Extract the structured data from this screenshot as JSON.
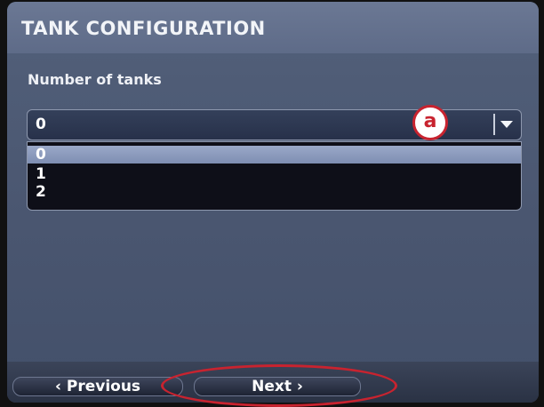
{
  "header": {
    "title": "TANK CONFIGURATION"
  },
  "form": {
    "label": "Number of tanks",
    "select": {
      "value": "0",
      "options": [
        "0",
        "1",
        "2"
      ],
      "selected_index": 0
    }
  },
  "annotations": {
    "callout": "a"
  },
  "footer": {
    "previous": "‹ Previous",
    "next": "Next ›"
  },
  "colors": {
    "annotation_red": "#c8232f",
    "highlight": "#8e9cc0"
  },
  "icons": {
    "dropdown": "chevron-down-icon"
  }
}
